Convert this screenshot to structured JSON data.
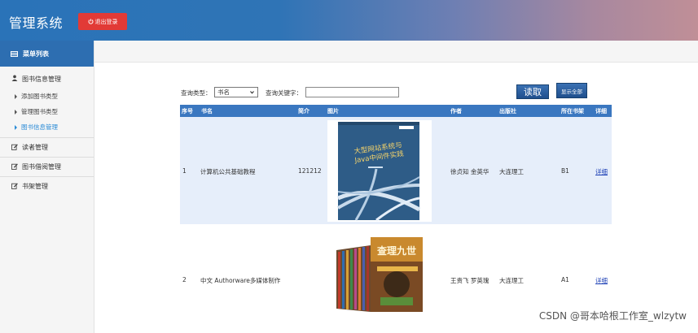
{
  "header": {
    "title": "管理系统",
    "logout_label": "退出登录"
  },
  "sidebar": {
    "head": "菜单列表",
    "groups": [
      {
        "title": "图书信息管理",
        "icon": "user-icon",
        "items": [
          {
            "label": "添加图书类型"
          },
          {
            "label": "管理图书类型"
          },
          {
            "label": "图书信息管理",
            "active": true
          }
        ]
      },
      {
        "title": "读者管理",
        "icon": "edit-icon"
      },
      {
        "title": "图书借阅管理",
        "icon": "edit-icon"
      },
      {
        "title": "书架管理",
        "icon": "edit-icon"
      }
    ]
  },
  "query": {
    "type_label": "查询类型：",
    "type_value": "书名",
    "keyword_label": "查询关键字：",
    "keyword_value": "",
    "read_button": "读取",
    "show_all_button": "显示全部"
  },
  "table": {
    "headers": [
      "序号",
      "书名",
      "简介",
      "图片",
      "作者",
      "出版社",
      "所在书架",
      "详细"
    ],
    "rows": [
      {
        "index": "1",
        "name": "计算机公共基础教程",
        "intro": "121212",
        "cover_text": "大型网站系统与Java中间件实践",
        "author": "徐贞知 金英华",
        "publisher": "大连理工",
        "shelf": "B1",
        "detail": "详细"
      },
      {
        "index": "2",
        "name": "中文 Authorware多媒体制作",
        "intro": "",
        "cover_text": "查理九世",
        "author": "王贵飞 罗英瑰",
        "publisher": "大连理工",
        "shelf": "A1",
        "detail": "详细"
      }
    ]
  },
  "watermark": "CSDN @哥本哈根工作室_wlzytw",
  "colors": {
    "header_blue": "#2a73b8",
    "logout_red": "#e23a36",
    "table_head": "#3a77c0",
    "active_link": "#2a8bd6"
  }
}
